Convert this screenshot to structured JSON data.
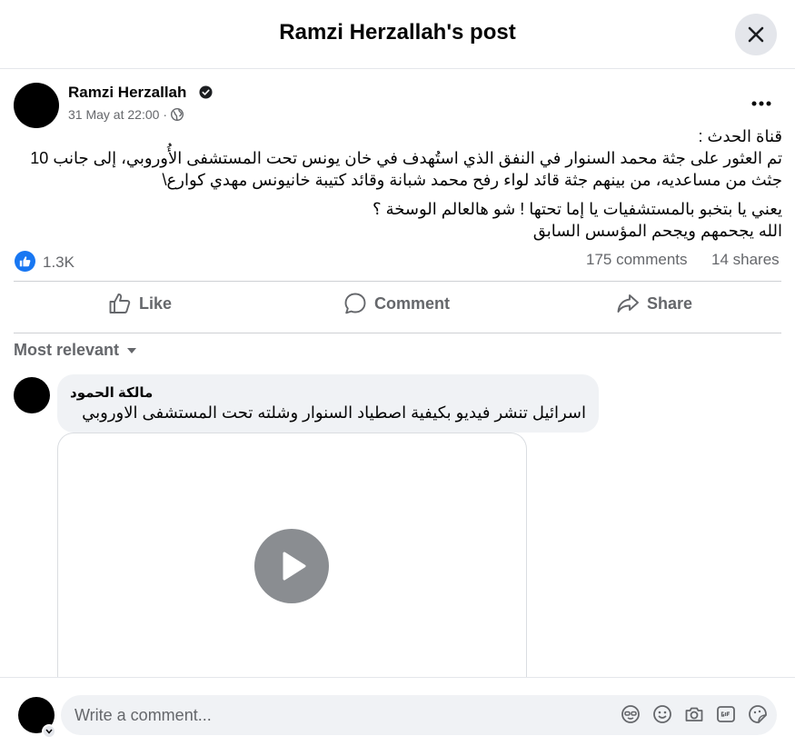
{
  "dialog": {
    "title": "Ramzi Herzallah's post"
  },
  "post": {
    "author": "Ramzi Herzallah",
    "timestamp": "31 May at 22:00",
    "meta_separator": "·",
    "body_lines": [
      "قناة الحدث :",
      "تم العثور على جثة محمد السنوار في النفق الذي استُهدف في خان يونس تحت المستشفى الأُوروبي، إلى جانب 10",
      "جثث من مساعديه، من بينهم جثة قائد لواء رفح محمد شبانة وقائد كتيبة خانيونس مهدي كوارع\\",
      "يعني يا بتخبو بالمستشفيات يا إما تحتها ! شو هالعالم الوسخة ؟",
      "الله يجحمهم ويجحم المؤسس السابق"
    ],
    "reactions_count": "1.3K",
    "comments_count": "175 comments",
    "shares_count": "14 shares"
  },
  "actions": {
    "like": "Like",
    "comment": "Comment",
    "share": "Share"
  },
  "comments_section": {
    "sort_label": "Most relevant"
  },
  "comment": {
    "author": "مالكة الحمود",
    "text": "اسرائيل تنشر فيديو بكيفية اصطياد السنوار وشلته تحت المستشفى الاوروبي"
  },
  "composer": {
    "placeholder": "Write a comment..."
  },
  "colors": {
    "accent": "#1877f2",
    "secondary_text": "#65676b",
    "bubble_bg": "#f0f2f5"
  },
  "icons": [
    "close-icon",
    "verified-badge-icon",
    "globe-icon",
    "more-options-icon",
    "like-reaction-icon",
    "like-icon",
    "comment-icon",
    "share-icon",
    "dropdown-caret-icon",
    "play-icon",
    "chevron-down-icon",
    "avatar-sticker-icon",
    "emoji-icon",
    "camera-icon",
    "gif-icon",
    "sticker-icon"
  ]
}
